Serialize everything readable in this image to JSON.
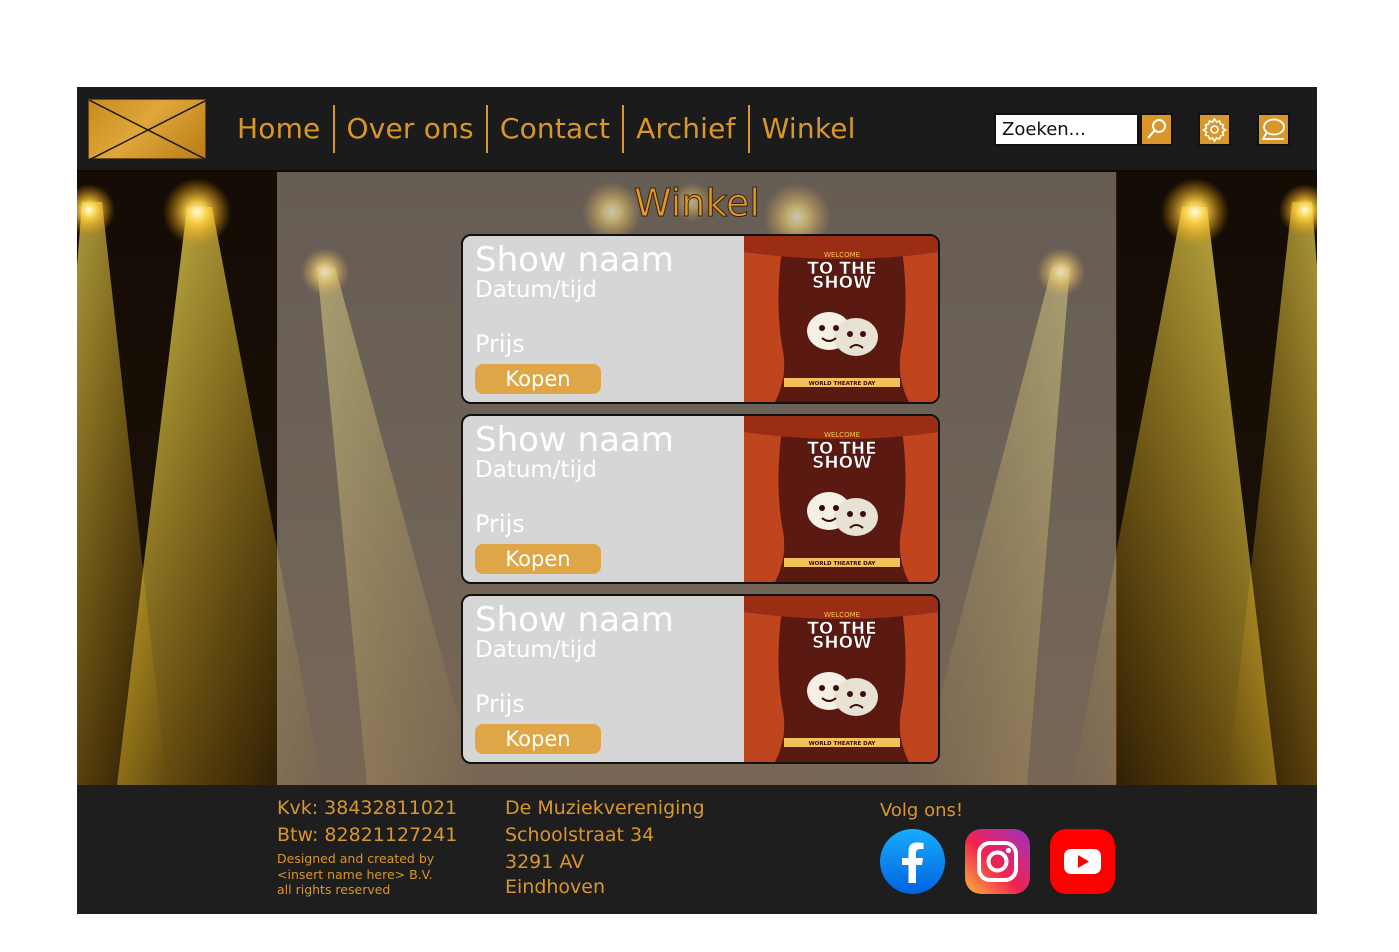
{
  "nav": {
    "items": [
      "Home",
      "Over ons",
      "Contact",
      "Archief",
      "Winkel"
    ]
  },
  "search": {
    "placeholder": "Zoeken..."
  },
  "icons": {
    "logo": "logo-placeholder-icon",
    "search": "search-icon",
    "settings": "gear-icon",
    "chat": "chat-icon",
    "facebook": "facebook-icon",
    "instagram": "instagram-icon",
    "youtube": "youtube-icon"
  },
  "page": {
    "title": "Winkel"
  },
  "shows": [
    {
      "name": "Show naam",
      "date": "Datum/tijd",
      "price": "Prijs",
      "buy": "Kopen"
    },
    {
      "name": "Show naam",
      "date": "Datum/tijd",
      "price": "Prijs",
      "buy": "Kopen"
    },
    {
      "name": "Show naam",
      "date": "Datum/tijd",
      "price": "Prijs",
      "buy": "Kopen"
    }
  ],
  "poster": {
    "top": "WELCOME",
    "line1": "TO THE",
    "line2": "SHOW",
    "banner": "WORLD THEATRE DAY"
  },
  "footer": {
    "kvk": "Kvk: 38432811021",
    "btw": "Btw: 82821127241",
    "credit": [
      "Designed and created by",
      "<insert name here> B.V.",
      "all rights reserved"
    ],
    "address": [
      "De Muziekvereniging",
      "Schoolstraat 34",
      "3291 AV",
      "Eindhoven"
    ],
    "follow": "Volg ons!"
  },
  "colors": {
    "accent": "#d9962a",
    "header_bg": "#1b1b1b",
    "card_bg": "#d6d6d6",
    "buy_button": "#dea647",
    "facebook": "#1877f2",
    "youtube": "#ff0000"
  }
}
